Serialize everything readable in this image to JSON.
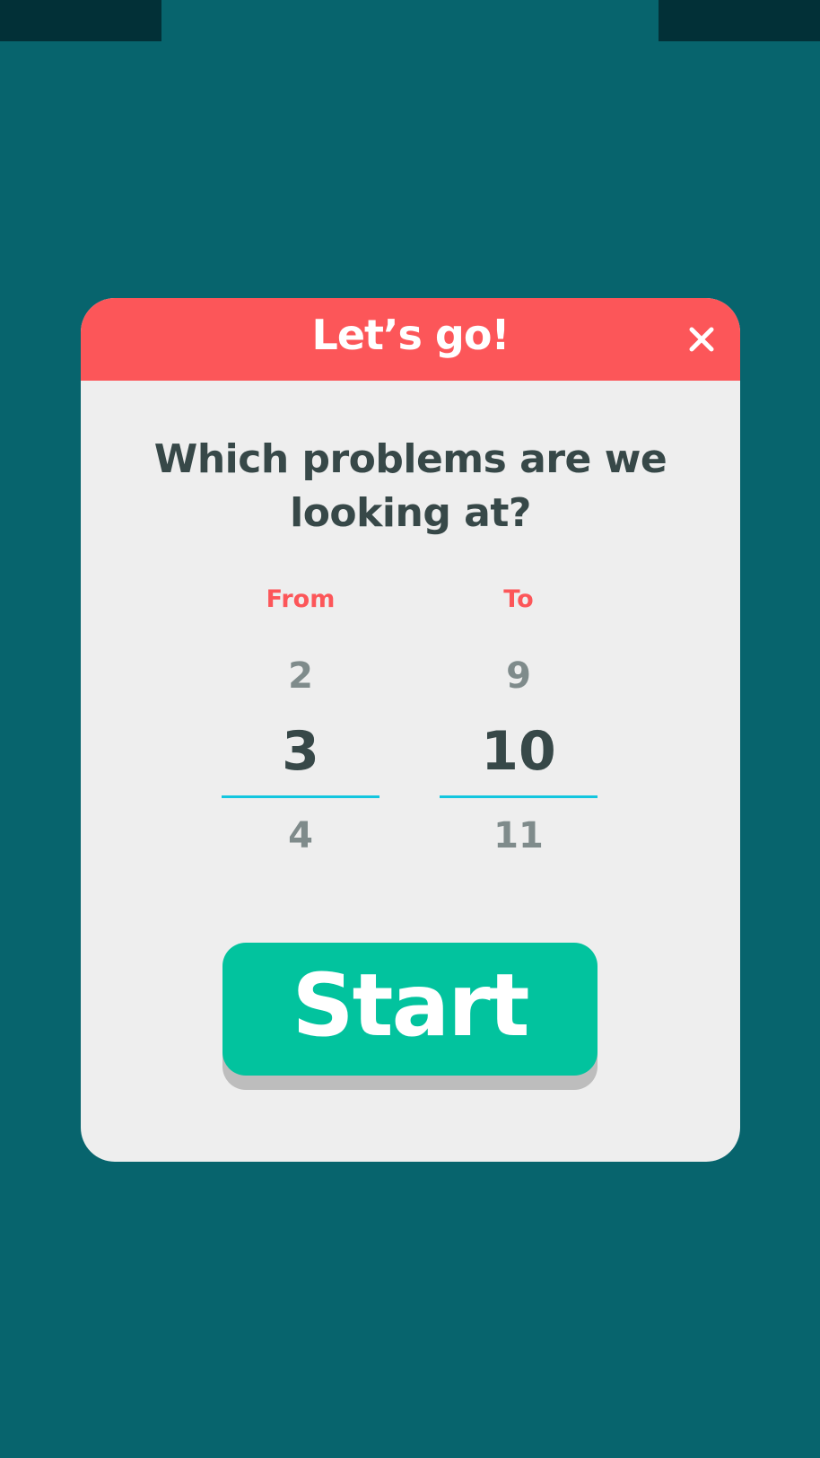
{
  "colors": {
    "background": "#07646d",
    "status_bar": "#023037",
    "header": "#fc5659",
    "panel": "#eeeeee",
    "accent_line": "#13c6df",
    "start": "#02c39e",
    "text": "#374848"
  },
  "dialog": {
    "title": "Let’s go!",
    "close_icon": "close-icon",
    "question": "Which problems are we looking at?",
    "from": {
      "label": "From",
      "prev": "2",
      "value": "3",
      "next": "4"
    },
    "to": {
      "label": "To",
      "prev": "9",
      "value": "10",
      "next": "11"
    },
    "start_label": "Start"
  }
}
